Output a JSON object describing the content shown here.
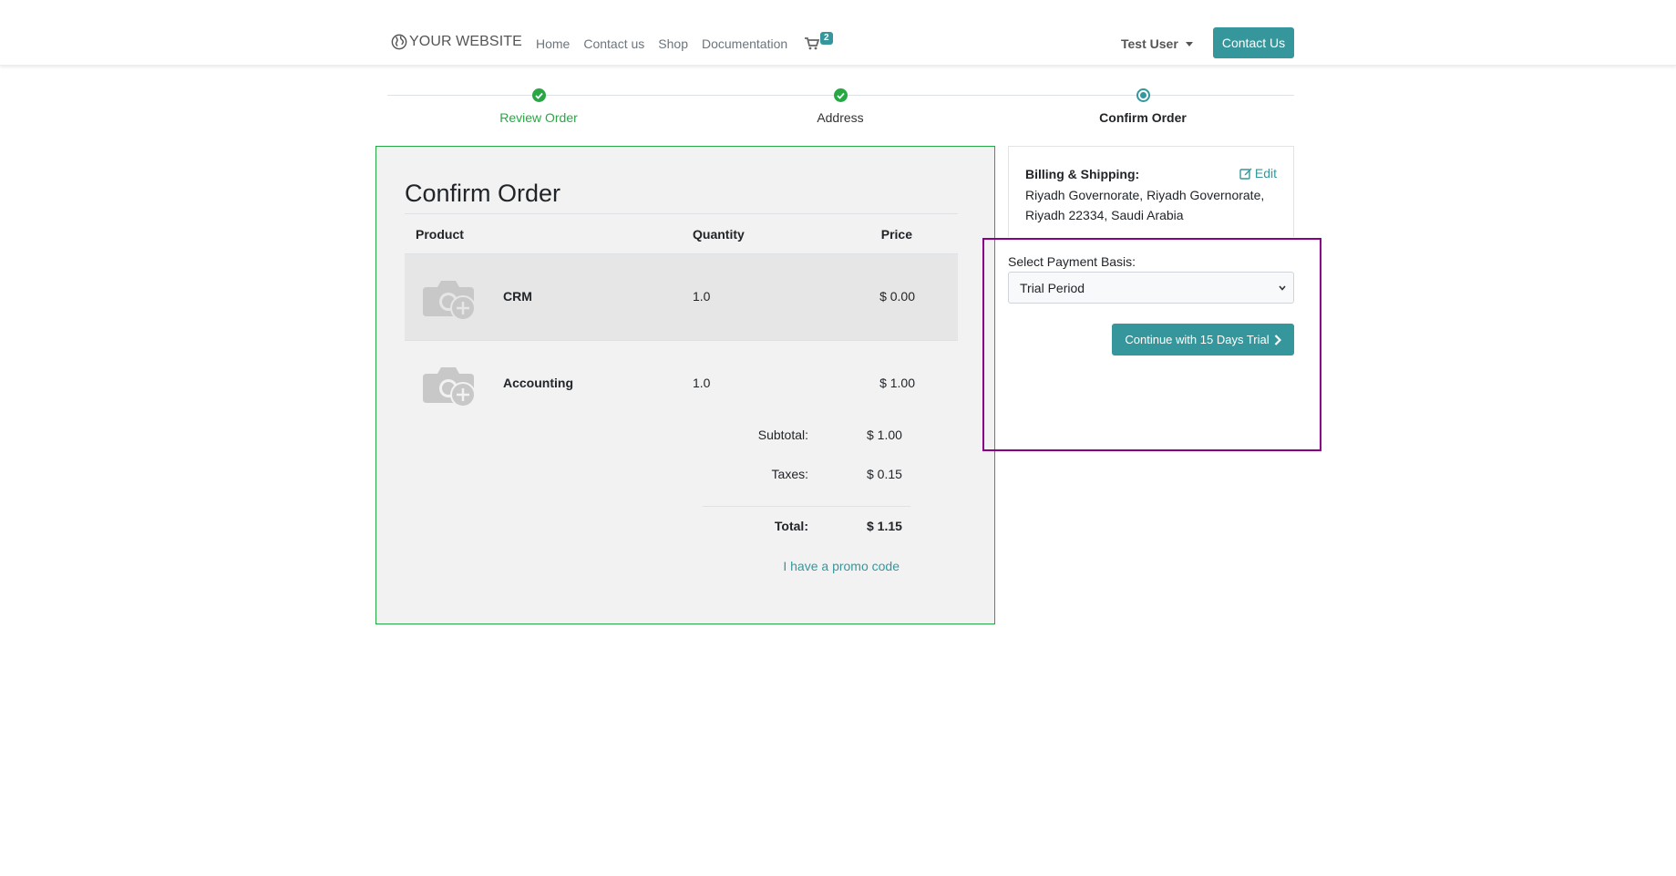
{
  "navbar": {
    "brand": "YOUR WEBSITE",
    "links": [
      "Home",
      "Contact us",
      "Shop",
      "Documentation"
    ],
    "cart_count": "2",
    "user": "Test User",
    "contact_button": "Contact Us"
  },
  "wizard": {
    "steps": [
      {
        "label": "Review Order",
        "state": "done"
      },
      {
        "label": "Address",
        "state": "done"
      },
      {
        "label": "Confirm Order",
        "state": "current"
      }
    ]
  },
  "order": {
    "title": "Confirm Order",
    "columns": {
      "product": "Product",
      "quantity": "Quantity",
      "price": "Price"
    },
    "items": [
      {
        "name": "CRM",
        "quantity": "1.0",
        "price": "$ 0.00"
      },
      {
        "name": "Accounting",
        "quantity": "1.0",
        "price": "$ 1.00"
      }
    ],
    "subtotal_label": "Subtotal:",
    "subtotal": "$ 1.00",
    "taxes_label": "Taxes:",
    "taxes": "$ 0.15",
    "total_label": "Total:",
    "total": "$ 1.15",
    "promo": "I have a promo code"
  },
  "billing": {
    "title": "Billing & Shipping:",
    "edit": "Edit",
    "address": "Riyadh Governorate, Riyadh Governorate, Riyadh 22334, Saudi Arabia"
  },
  "payment": {
    "label": "Select Payment Basis:",
    "selected": "Trial Period",
    "continue_button": "Continue with 15 Days Trial"
  },
  "colors": {
    "primary": "#35979c",
    "success": "#28a745",
    "highlight": "#8b008b"
  },
  "icons": [
    "globe-icon",
    "cart-icon",
    "check-icon",
    "edit-icon",
    "chevron-right-icon",
    "product-placeholder-icon"
  ]
}
